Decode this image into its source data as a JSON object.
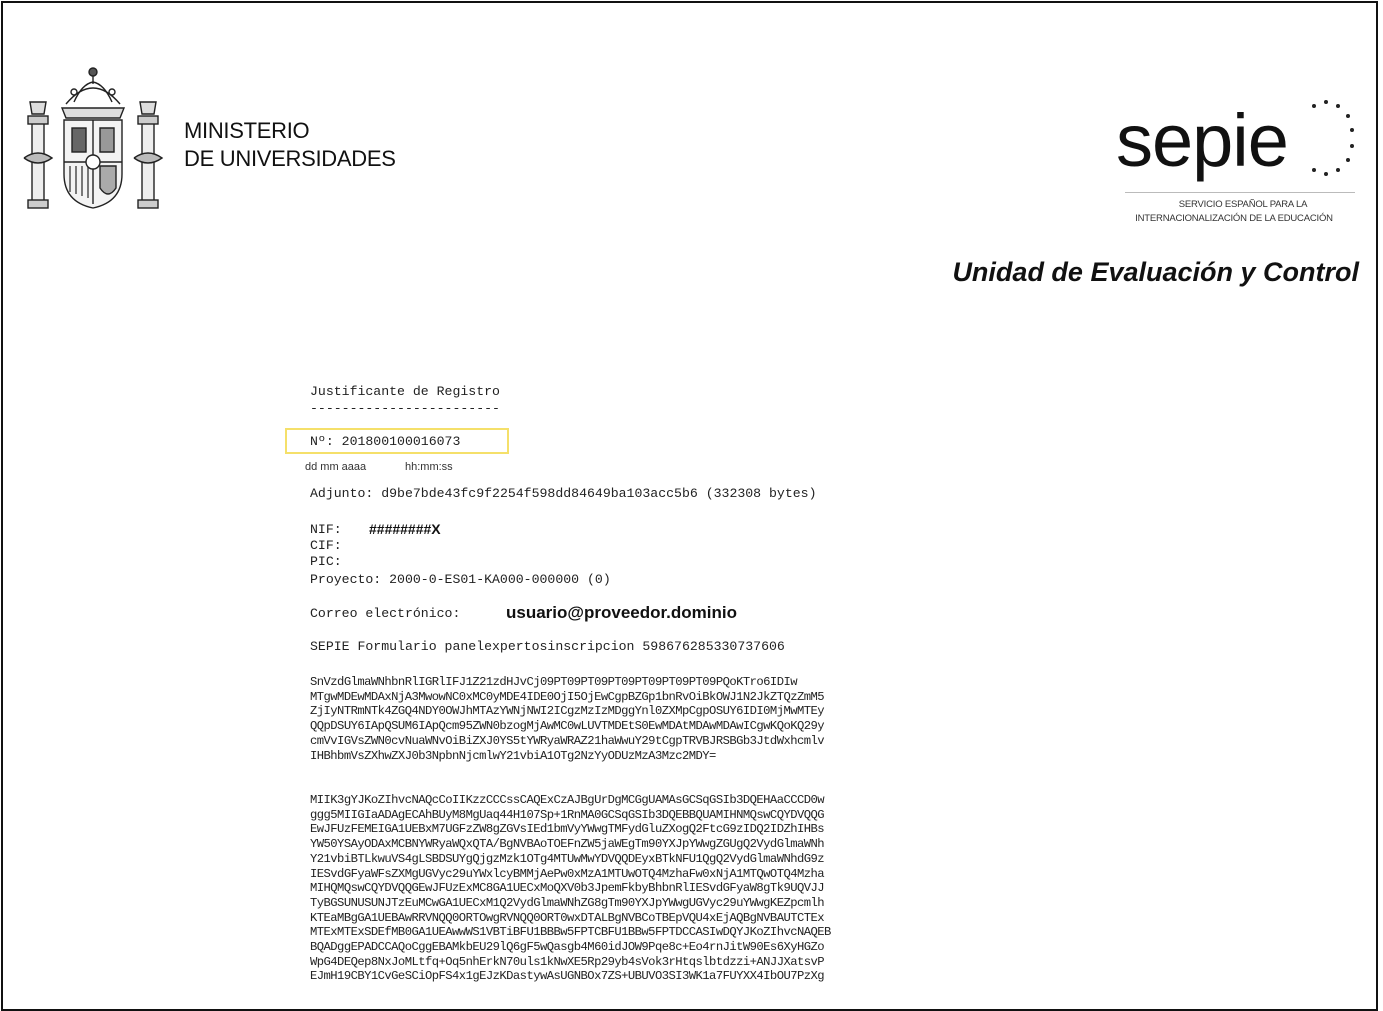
{
  "header": {
    "ministry_line1": "MINISTERIO",
    "ministry_line2": "DE UNIVERSIDADES",
    "logo_text": "sepie",
    "logo_subtitle_line1": "SERVICIO ESPAÑOL PARA LA",
    "logo_subtitle_line2": "INTERNACIONALIZACIÓN DE LA EDUCACIÓN",
    "unit_title": "Unidad de Evaluación y Control"
  },
  "receipt": {
    "title": "Justificante de Registro",
    "underline": "------------------------",
    "number_label": "Nº: ",
    "number_value": "201800100016073",
    "date_placeholder": "dd mm aaaa",
    "time_placeholder": "hh:mm:ss",
    "attachment_label": "Adjunto: ",
    "attachment_value": "d9be7bde43fc9f2254f598dd84649ba103acc5b6 (332308 bytes)",
    "nif_label": "NIF:",
    "nif_value": "########X",
    "cif_label": "CIF:",
    "pic_label": "PIC:",
    "project_label": "Proyecto: ",
    "project_value": "2000-0-ES01-KA000-000000 (0)",
    "email_label": "Correo electrónico:",
    "email_value": "usuario@proveedor.dominio",
    "form_line": "SEPIE Formulario panelexpertosinscripcion 598676285330737606",
    "hash_block1": [
      "SnVzdGlmaWNhbnRlIGRlIFJ1Z21zdHJvCj09PT09PT09PT09PT09PT09PT09PQoKTro6IDIw",
      "MTgwMDEwMDAxNjA3MwowNC0xMC0yMDE4IDE0OjI5OjEwCgpBZGp1bnRvOiBkOWJ1N2JkZTQzZmM5",
      "ZjIyNTRmNTk4ZGQ4NDY0OWJhMTAzYWNjNWI2ICgzMzIzMDggYnl0ZXMpCgpOSUY6IDI0MjMwMTEy",
      "QQpDSUY6IApQSUM6IApQcm95ZWN0bzogMjAwMC0wLUVTMDEtS0EwMDAtMDAwMDAwICgwKQoKQ29y",
      "cmVvIGVsZWN0cvNuaWNvOiBiZXJ0YS5tYWRyaWRAZ21haWwuY29tCgpTRVBJRSBGb3JtdWxhcmlv",
      "IHBhbmVsZXhwZXJ0b3NpbnNjcmlwY21vbiA1OTg2NzYyODUzMzA3Mzc2MDY="
    ],
    "hash_block2": [
      "MIIK3gYJKoZIhvcNAQcCoIIKzzCCCssCAQExCzAJBgUrDgMCGgUAMAsGCSqGSIb3DQEHAaCCCD0w",
      "ggg5MIIGIaADAgECAhBUyM8MgUaq44H107Sp+1RnMA0GCSqGSIb3DQEBBQUAMIHNMQswCQYDVQQG",
      "EwJFUzFEMEIGA1UEBxM7UGFzZW8gZGVsIEd1bmVyYWwgTMFydGluZXogQ2FtcG9zIDQ2IDZhIHBs",
      "YW50YSAyODAxMCBNYWRyaWQxQTA/BgNVBAoTOEFnZW5jaWEgTm90YXJpYWwgZGUgQ2VydGlmaWNh",
      "Y21vbiBTLkwuVS4gLSBDSUYgQjgzMzk1OTg4MTUwMwYDVQQDEyxBTkNFU1QgQ2VydGlmaWNhdG9z",
      "IESvdGFyaWFsZXMgUGVyc29uYWxlcyBMMjAePw0xMzA1MTUwOTQ4MzhaFw0xNjA1MTQwOTQ4Mzha",
      "MIHQMQswCQYDVQQGEwJFUzExMC8GA1UECxMoQXV0b3JpemFkbyBhbnRlIESvdGFyaW8gTk9UQVJJ",
      "TyBGSUNUSUNJTzEuMCwGA1UECxM1Q2VydGlmaWNhZG8gTm90YXJpYWwgUGVyc29uYWwgKEZpcmlh",
      "KTEaMBgGA1UEBAwRRVNQQ0ORTOwgRVNQQ0ORT0wxDTALBgNVBCoTBEpVQU4xEjAQBgNVBAUTCTEx",
      "MTExMTExSDEfMB0GA1UEAwwWS1VBTiBFU1BBBw5FPTCBFU1BBw5FPTDCCASIwDQYJKoZIhvcNAQEB",
      "BQADggEPADCCAQoCggEBAMkbEU29lQ6gF5wQasgb4M60idJOW9Pqe8c+Eo4rnJitW90Es6XyHGZo",
      "WpG4DEQep8NxJoMLtfq+Oq5nhErkN70uls1kNwXE5Rp29yb4sVok3rHtqslbtdzzi+ANJJXatsvP",
      "EJmH19CBY1CvGeSCiOpFS4x1gEJzKDastywAsUGNBOx7ZS+UBUVO3SI3WK1a7FUYXX4IbOU7PzXg"
    ]
  }
}
